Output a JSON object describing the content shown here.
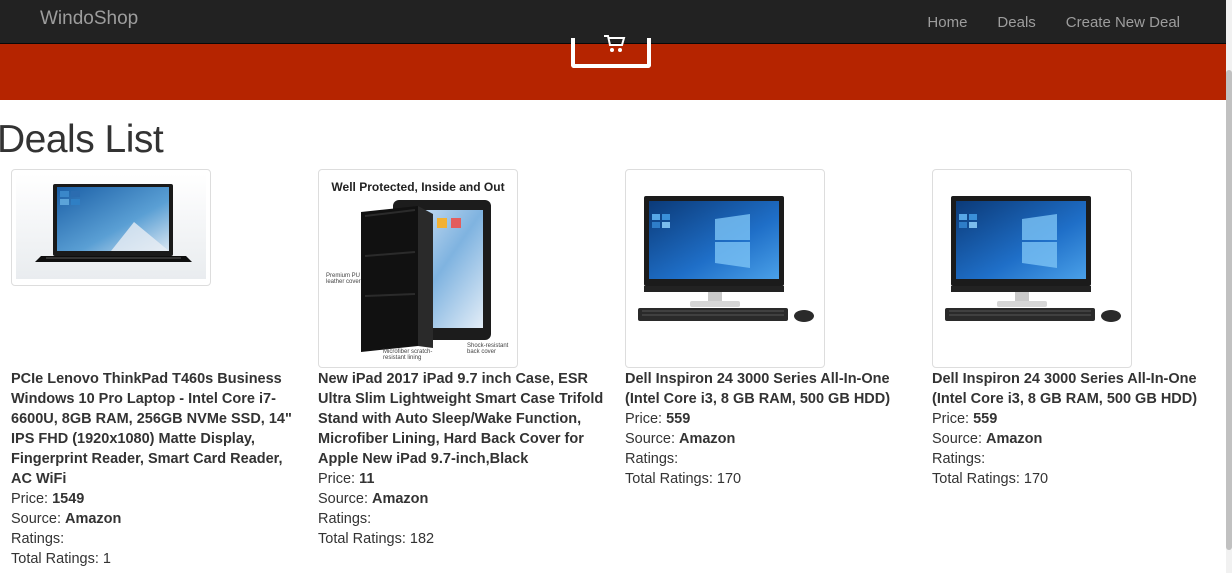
{
  "navbar": {
    "brand": "WindoShop",
    "links": [
      "Home",
      "Deals",
      "Create New Deal"
    ]
  },
  "page": {
    "title": "Deals List"
  },
  "labels": {
    "price": "Price: ",
    "source": "Source: ",
    "ratings": "Ratings:",
    "total_ratings": "Total Ratings: "
  },
  "deals": [
    {
      "title": "PCIe Lenovo ThinkPad T460s Business Windows 10 Pro Laptop - Intel Core i7-6600U, 8GB RAM, 256GB NVMe SSD, 14\" IPS FHD (1920x1080) Matte Display, Fingerprint Reader, Smart Card Reader, AC WiFi",
      "price": "1549",
      "source": "Amazon",
      "total_ratings": "1",
      "image": "laptop-image"
    },
    {
      "title": "New iPad 2017 iPad 9.7 inch Case, ESR Ultra Slim Lightweight Smart Case Trifold Stand with Auto Sleep/Wake Function, Microfiber Lining, Hard Back Cover for Apple New iPad 9.7-inch,Black",
      "price": "11",
      "source": "Amazon",
      "total_ratings": "182",
      "image": "ipad-case-image",
      "image_caption": "Well Protected, Inside and Out",
      "image_labels": [
        "Premium PU leather cover",
        "Microfiber scratch-resistant lining",
        "Shock-resistant back cover"
      ]
    },
    {
      "title": "Dell Inspiron 24 3000 Series All-In-One (Intel Core i3, 8 GB RAM, 500 GB HDD)",
      "price": "559",
      "source": "Amazon",
      "total_ratings": "170",
      "image": "desktop-image"
    },
    {
      "title": "Dell Inspiron 24 3000 Series All-In-One (Intel Core i3, 8 GB RAM, 500 GB HDD)",
      "price": "559",
      "source": "Amazon",
      "total_ratings": "170",
      "image": "desktop-image"
    }
  ]
}
